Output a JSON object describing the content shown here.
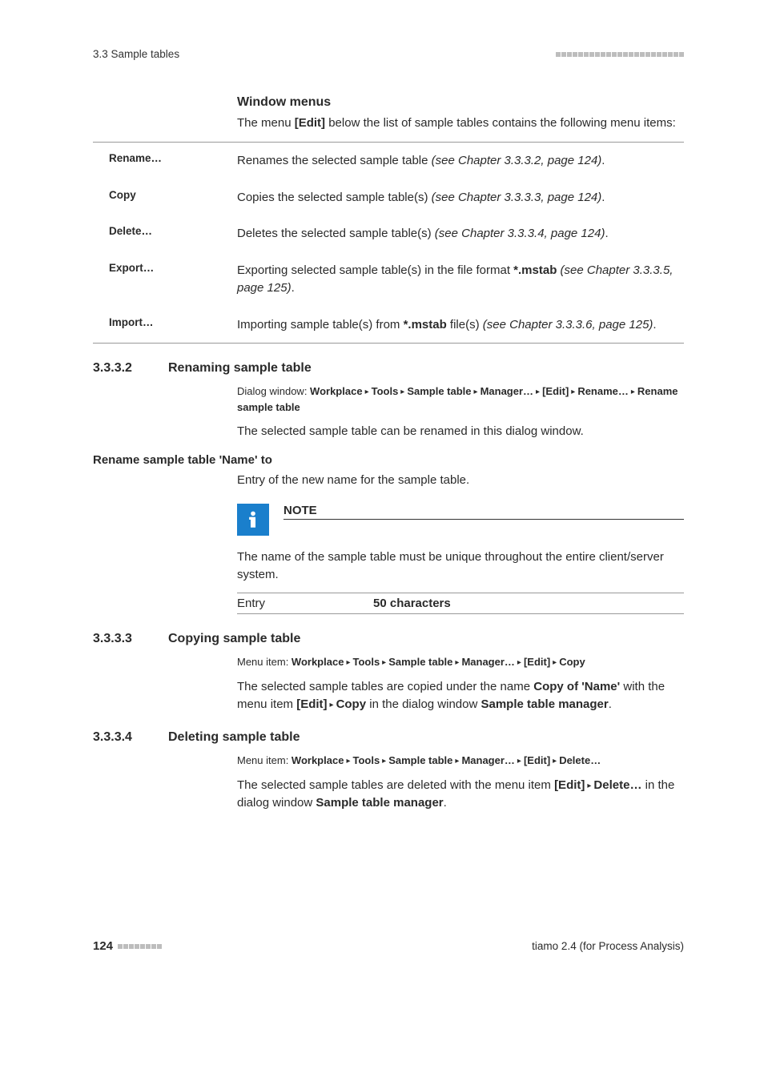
{
  "header": {
    "section_ref": "3.3 Sample tables"
  },
  "window_menus": {
    "heading": "Window menus",
    "intro_pre": "The menu ",
    "intro_bold": "[Edit]",
    "intro_post": " below the list of sample tables contains the following menu items:",
    "rows": [
      {
        "label": "Rename…",
        "desc_pre": "Renames the selected sample table ",
        "desc_italic": "(see Chapter 3.3.3.2, page 124)",
        "desc_post": "."
      },
      {
        "label": "Copy",
        "desc_pre": "Copies the selected sample table(s) ",
        "desc_italic": "(see Chapter 3.3.3.3, page 124)",
        "desc_post": "."
      },
      {
        "label": "Delete…",
        "desc_pre": "Deletes the selected sample table(s) ",
        "desc_italic": "(see Chapter 3.3.3.4, page 124)",
        "desc_post": "."
      },
      {
        "label": "Export…",
        "desc_pre": "Exporting selected sample table(s) in the file format ",
        "desc_bold": "*.mstab",
        "desc_mid": " ",
        "desc_italic": "(see Chapter 3.3.3.5, page 125)",
        "desc_post": "."
      },
      {
        "label": "Import…",
        "desc_pre": "Importing sample table(s) from ",
        "desc_bold": "*.mstab",
        "desc_mid": " file(s) ",
        "desc_italic": "(see Chapter 3.3.3.6, page 125)",
        "desc_post": "."
      }
    ]
  },
  "sec_3332": {
    "num": "3.3.3.2",
    "title": "Renaming sample table",
    "path_label": "Dialog window: ",
    "path_parts": [
      "Workplace",
      "Tools",
      "Sample table",
      "Manager…",
      "[Edit]",
      "Rename…",
      "Rename sample table"
    ],
    "body": "The selected sample table can be renamed in this dialog window.",
    "subhead": "Rename sample table 'Name' to",
    "sub_body": "Entry of the new name for the sample table.",
    "note_title": "NOTE",
    "note_body": "The name of the sample table must be unique throughout the entire client/server system.",
    "entry_label": "Entry",
    "entry_value": "50 characters"
  },
  "sec_3333": {
    "num": "3.3.3.3",
    "title": "Copying sample table",
    "path_label": "Menu item: ",
    "path_parts": [
      "Workplace",
      "Tools",
      "Sample table",
      "Manager…",
      "[Edit]",
      "Copy"
    ],
    "body_1a": "The selected sample tables are copied under the name ",
    "body_1b": "Copy of 'Name'",
    "body_1c": " with the menu item ",
    "body_1d": "[Edit]",
    "body_1e": "Copy",
    "body_1f": " in the dialog window ",
    "body_1g": "Sample table manager",
    "body_1h": "."
  },
  "sec_3334": {
    "num": "3.3.3.4",
    "title": "Deleting sample table",
    "path_label": "Menu item: ",
    "path_parts": [
      "Workplace",
      "Tools",
      "Sample table",
      "Manager…",
      "[Edit]",
      "Delete…"
    ],
    "body_2a": "The selected sample tables are deleted with the menu item ",
    "body_2b": "[Edit]",
    "body_2c": "Delete…",
    "body_2d": " in the dialog window ",
    "body_2e": "Sample table manager",
    "body_2f": "."
  },
  "footer": {
    "page_number": "124",
    "product": "tiamo 2.4 (for Process Analysis)"
  }
}
